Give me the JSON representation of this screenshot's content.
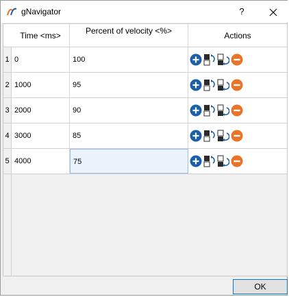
{
  "window": {
    "title": "gNavigator",
    "help_label": "?"
  },
  "table": {
    "headers": {
      "time": "Time <ms>",
      "percent": "Percent of velocity <%>",
      "actions": "Actions"
    },
    "rows": [
      {
        "num": "1",
        "time": "0",
        "percent": "100"
      },
      {
        "num": "2",
        "time": "1000",
        "percent": "95"
      },
      {
        "num": "3",
        "time": "2000",
        "percent": "90"
      },
      {
        "num": "4",
        "time": "3000",
        "percent": "85"
      },
      {
        "num": "5",
        "time": "4000",
        "percent": "75"
      }
    ],
    "action_icons": [
      "add-icon",
      "copy-icon",
      "paste-icon",
      "remove-icon"
    ]
  },
  "buttons": {
    "ok": "OK"
  },
  "colors": {
    "add": "#1a5fa8",
    "remove": "#e8742a",
    "selected_bg": "#eaf3fb",
    "focus_border": "#0078d7"
  }
}
